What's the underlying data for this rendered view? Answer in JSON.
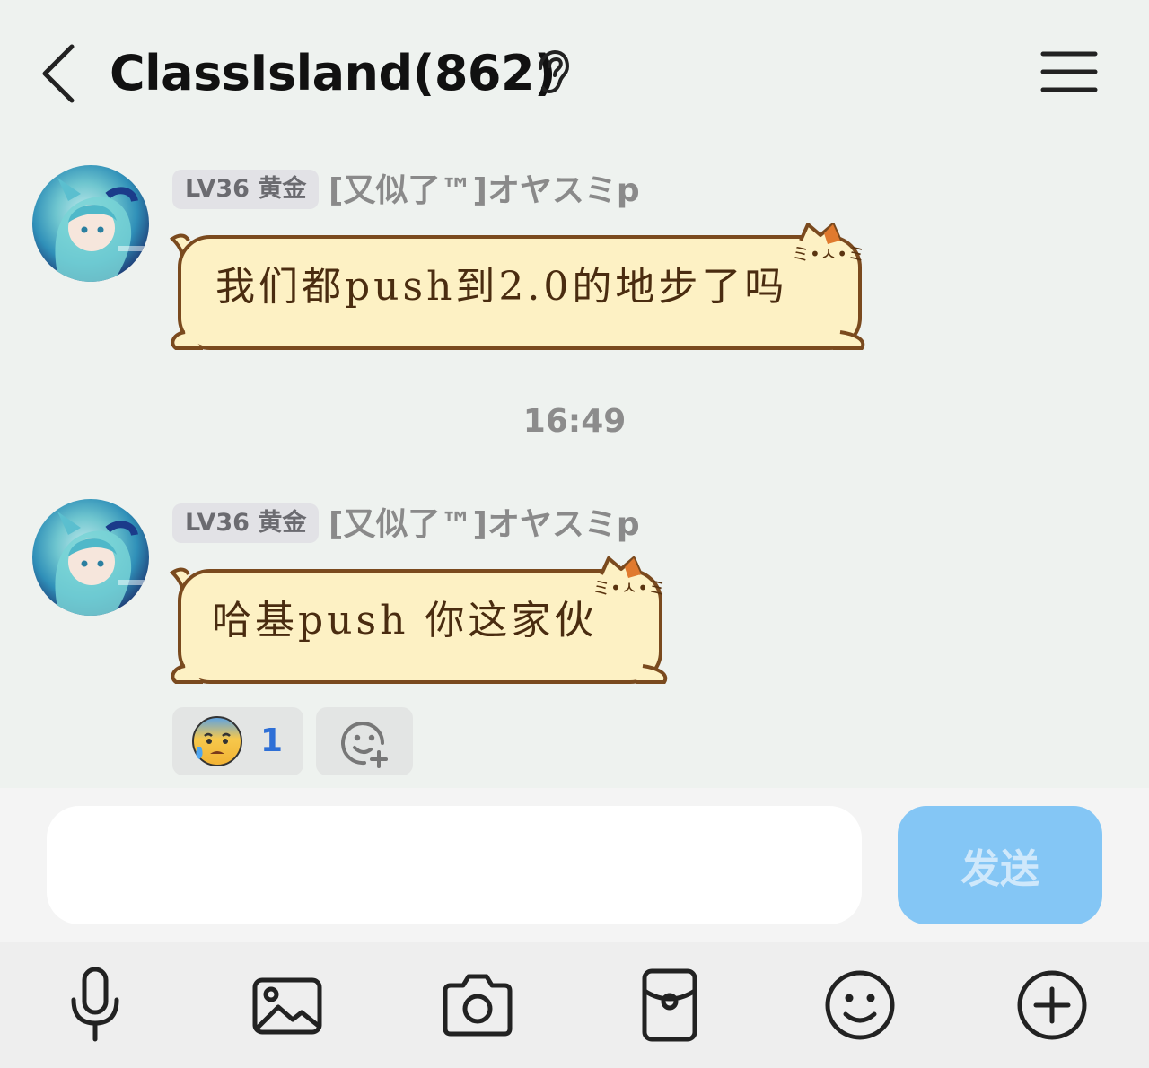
{
  "header": {
    "title": "ClassIsland(862)",
    "back_icon": "chevron-left-icon",
    "ear_icon": "ear-icon",
    "menu_icon": "hamburger-menu-icon"
  },
  "messages": [
    {
      "badge": "LV36 黄金",
      "sender": "[又似了™]オヤスミp",
      "text": "我们都push到2.0的地步了吗"
    },
    {
      "badge": "LV36 黄金",
      "sender": "[又似了™]オヤスミp",
      "text": "哈基push 你这家伙",
      "reactions": [
        {
          "emoji": "😰",
          "count": "1"
        }
      ],
      "add_reaction_icon": "add-emoji-icon"
    }
  ],
  "timestamp": "16:49",
  "input": {
    "value": "",
    "placeholder": "",
    "send_label": "发送"
  },
  "toolbar": {
    "items": [
      "microphone-icon",
      "image-icon",
      "camera-icon",
      "red-packet-icon",
      "emoji-icon",
      "plus-icon"
    ]
  },
  "colors": {
    "background": "#eef2ef",
    "bubble_fill": "#fdf1c4",
    "bubble_border": "#7a4a1e",
    "send_button": "#84c6f5",
    "reaction_count": "#2e6fd6"
  }
}
